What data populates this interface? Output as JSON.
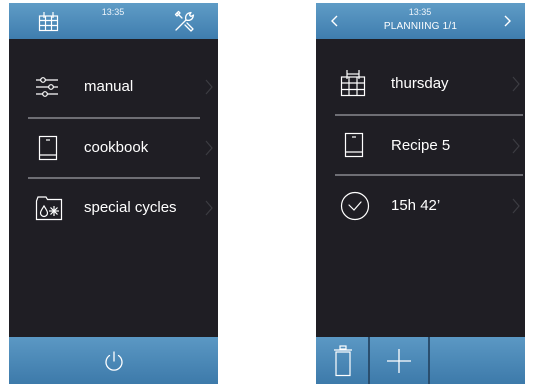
{
  "left_screen": {
    "header": {
      "time": "13:35",
      "calendar_icon": "calendar-icon",
      "tools_icon": "tools-icon"
    },
    "menu": [
      {
        "label": "manual",
        "icon": "sliders-icon"
      },
      {
        "label": "cookbook",
        "icon": "book-icon"
      },
      {
        "label": "special cycles",
        "icon": "special-cycles-icon"
      }
    ],
    "footer": {
      "power_icon": "power-icon"
    }
  },
  "right_screen": {
    "header": {
      "time": "13:35",
      "title": "PLANNIING 1/1",
      "prev_icon": "chevron-left-icon",
      "next_icon": "chevron-right-icon"
    },
    "items": [
      {
        "label": "thursday",
        "icon": "calendar-icon"
      },
      {
        "label": "Recipe 5",
        "icon": "book-icon"
      },
      {
        "label": "15h 42’",
        "icon": "clock-icon"
      }
    ],
    "footer": {
      "delete_icon": "trash-icon",
      "add_icon": "plus-icon"
    }
  },
  "colors": {
    "screen_bg": "#1f1e24",
    "bar_blue": "#4a88b8",
    "separator": "#6e6e74",
    "text": "#ffffff",
    "chevron": "#3c3c42"
  }
}
